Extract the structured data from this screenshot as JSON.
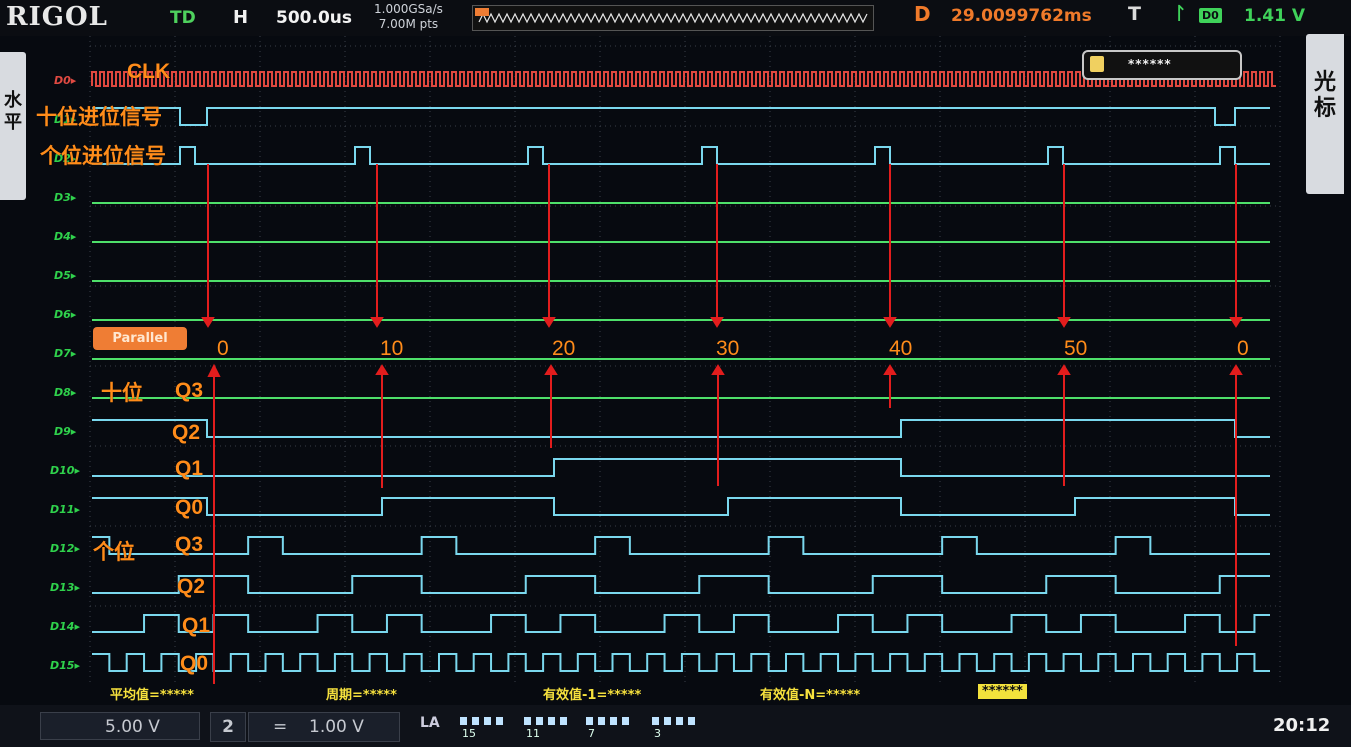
{
  "header": {
    "brand": "RIGOL",
    "mode": "TD",
    "h_label": "H",
    "timebase": "500.0us",
    "sample_rate": "1.000GSa/s",
    "memory_depth": "7.00M pts",
    "delay_label": "D",
    "delay": "29.0099762ms",
    "trigger_label": "T",
    "trigger_source": "D0",
    "trigger_level": "1.41 V"
  },
  "side_tabs": {
    "left": "水平",
    "right": "光标"
  },
  "channels": [
    "D0",
    "D1",
    "D2",
    "D3",
    "D4",
    "D5",
    "D6",
    "D7",
    "D8",
    "D9",
    "D10",
    "D11",
    "D12",
    "D13",
    "D14",
    "D15"
  ],
  "annotations": {
    "clk": "CLK",
    "tens_carry": "十位进位信号",
    "ones_carry": "个位进位信号",
    "tens": "十位",
    "ones": "个位",
    "q3": "Q3",
    "q2": "Q2",
    "q1": "Q1",
    "q0": "Q0",
    "values": [
      "0",
      "10",
      "20",
      "30",
      "40",
      "50",
      "0"
    ]
  },
  "decoder_label": "Parallel",
  "mini_box_text": "******",
  "measurements": {
    "avg": "平均值=*****",
    "period": "周期=*****",
    "rms1": "有效值-1=*****",
    "rmsn": "有效值-N=*****",
    "last": "******"
  },
  "footer": {
    "ch1_scale": "5.00 V",
    "ch2_number": "2",
    "ch2_scale": "1.00 V",
    "la_label": "LA",
    "la_groups": [
      "15",
      "11",
      "7",
      "3"
    ],
    "clock": "20:12"
  },
  "colors": {
    "digital_low": "#4ee06a",
    "digital_high": "#7ad8ee",
    "clock_trace": "#e0483f",
    "annotation": "#ff8c1a",
    "marker_arrow": "#e21d1d",
    "measurement": "#f6e13d"
  }
}
